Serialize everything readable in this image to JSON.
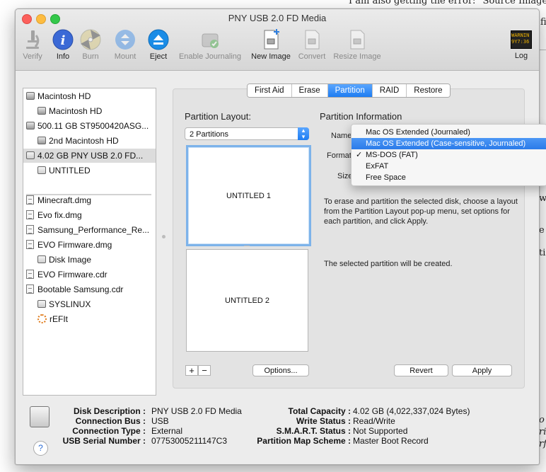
{
  "background": {
    "line1": "I am also getting the error: \"Source Image",
    "right_fragments": [
      "fi",
      "wh",
      "e I",
      "tic",
      "o y",
      "rio",
      "rfo"
    ]
  },
  "window": {
    "title": "PNY USB 2.0 FD Media"
  },
  "toolbar": {
    "verify": "Verify",
    "info": "Info",
    "burn": "Burn",
    "mount": "Mount",
    "eject": "Eject",
    "enable_journaling": "Enable Journaling",
    "new_image": "New Image",
    "convert": "Convert",
    "resize_image": "Resize Image",
    "log": "Log",
    "log_icon_line1": "WARNIN",
    "log_icon_line2": "9Y7:36"
  },
  "sidebar": {
    "items": [
      {
        "label": "Macintosh HD"
      },
      {
        "label": "Macintosh HD"
      },
      {
        "label": "500.11 GB ST9500420ASG..."
      },
      {
        "label": "2nd Macintosh HD"
      },
      {
        "label": "4.02 GB PNY USB 2.0 FD..."
      },
      {
        "label": "UNTITLED"
      },
      {
        "label": "Minecraft.dmg"
      },
      {
        "label": "Evo fix.dmg"
      },
      {
        "label": "Samsung_Performance_Re..."
      },
      {
        "label": "EVO Firmware.dmg"
      },
      {
        "label": "Disk Image"
      },
      {
        "label": "EVO Firmware.cdr"
      },
      {
        "label": "Bootable Samsung.cdr"
      },
      {
        "label": "SYSLINUX"
      },
      {
        "label": "rEFIt"
      }
    ]
  },
  "tabs": {
    "first_aid": "First Aid",
    "erase": "Erase",
    "partition": "Partition",
    "raid": "RAID",
    "restore": "Restore"
  },
  "partition": {
    "layout_label": "Partition Layout:",
    "layout_value": "2 Partitions",
    "partitions": [
      "UNTITLED 1",
      "UNTITLED 2"
    ],
    "plus": "+",
    "minus": "−",
    "options_button": "Options...",
    "info_title": "Partition Information",
    "name_label": "Name",
    "format_label": "Format",
    "size_label": "Size",
    "description": "To erase and partition the selected disk, choose a layout from the Partition Layout pop-up menu, set options for each partition, and click Apply.",
    "status": "The selected partition will be created.",
    "revert_button": "Revert",
    "apply_button": "Apply"
  },
  "format_menu": {
    "items": [
      {
        "label": "Mac OS Extended (Journaled)"
      },
      {
        "label": "Mac OS Extended (Case-sensitive, Journaled)"
      },
      {
        "label": "MS-DOS (FAT)",
        "check": "✓"
      },
      {
        "label": "ExFAT"
      },
      {
        "label": "Free Space"
      }
    ]
  },
  "footer": {
    "disk_description_key": "Disk Description :",
    "disk_description": "PNY USB 2.0 FD Media",
    "connection_bus_key": "Connection Bus :",
    "connection_bus": "USB",
    "connection_type_key": "Connection Type :",
    "connection_type": "External",
    "serial_key": "USB Serial Number :",
    "serial": "07753005211147C3",
    "total_capacity_key": "Total Capacity :",
    "total_capacity": "4.02 GB (4,022,337,024 Bytes)",
    "write_status_key": "Write Status :",
    "write_status": "Read/Write",
    "smart_key": "S.M.A.R.T. Status :",
    "smart": "Not Supported",
    "partition_map_key": "Partition Map Scheme :",
    "partition_map": "Master Boot Record",
    "help": "?"
  },
  "colors": {
    "accent": "#1d7cf2",
    "menu_highlight": "#2b7be9",
    "selected_partition_border": "#7db3ea"
  }
}
